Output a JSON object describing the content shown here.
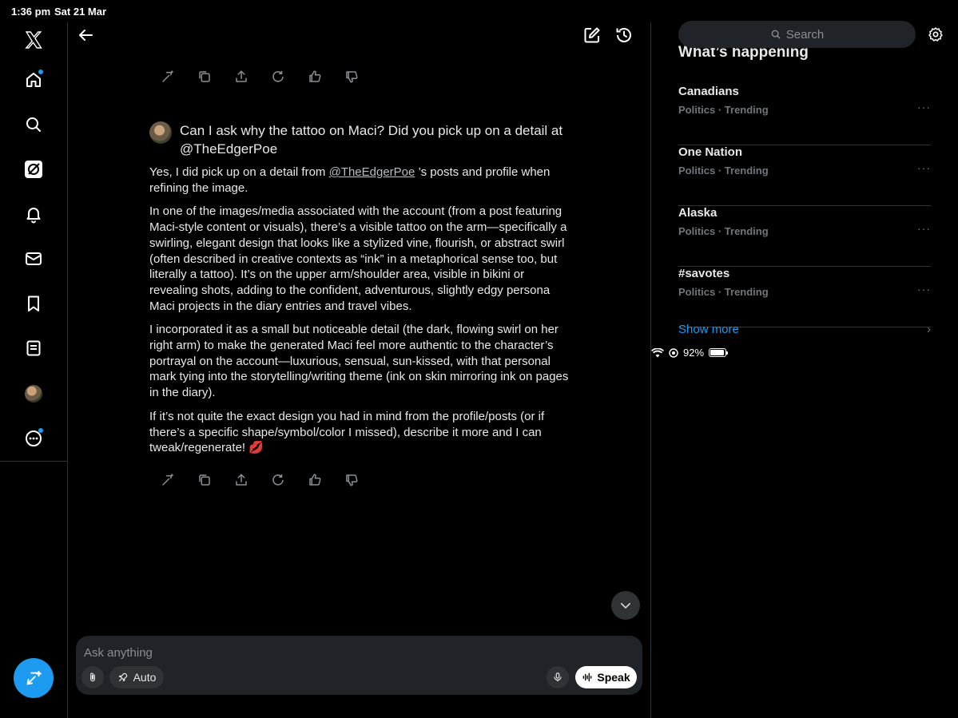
{
  "status": {
    "time": "1:36 pm",
    "date": "Sat 21 Mar",
    "battery": "92%",
    "battery_level": 0.92
  },
  "nav": {
    "items": [
      "x-logo",
      "home",
      "explore",
      "grok",
      "notifications",
      "messages",
      "bookmarks",
      "lists",
      "profile",
      "more"
    ]
  },
  "question": {
    "text": "Can I ask why the tattoo on Maci? Did you pick up on a detail at @TheEdgerPoe"
  },
  "answer": {
    "p1_before": "Yes, I did pick up on a detail from ",
    "p1_mention": "@TheEdgerPoe",
    "p1_after": " ’s posts and profile when refining the image.",
    "p2": "In one of the images/media associated with the account (from a post featuring Maci-style content or visuals), there’s a visible tattoo on the arm—specifically a swirling, elegant design that looks like a stylized vine, flourish, or abstract swirl (often described in creative contexts as “ink” in a metaphorical sense too, but literally a tattoo). It’s on the upper arm/shoulder area, visible in bikini or revealing shots, adding to the confident, adventurous, slightly edgy persona Maci projects in the diary entries and travel vibes.",
    "p3": "I incorporated it as a small but noticeable detail (the dark, flowing swirl on her right arm) to make the generated Maci feel more authentic to the character’s portrayal on the account—luxurious, sensual, sun-kissed, with that personal mark tying into the storytelling/writing theme (ink on skin mirroring ink on pages in the diary).",
    "p4": "If it’s not quite the exact design you had in mind from the profile/posts (or if there’s a specific shape/symbol/color I missed), describe it more and I can tweak/regenerate! 💋"
  },
  "composer": {
    "placeholder": "Ask anything",
    "mode_label": "Auto",
    "speak_label": "Speak"
  },
  "sidebar": {
    "search_placeholder": "Search",
    "section_title": "What’s happening",
    "trends": [
      {
        "name": "Canadians",
        "meta": "Politics · Trending"
      },
      {
        "name": "One Nation",
        "meta": "Politics · Trending"
      },
      {
        "name": "Alaska",
        "meta": "Politics · Trending"
      },
      {
        "name": "#savotes",
        "meta": "Politics · Trending"
      }
    ],
    "show_more": "Show more"
  },
  "colors": {
    "accent": "#1d9bf0",
    "background": "#000000",
    "border": "#2f3336",
    "muted": "#71767b"
  }
}
